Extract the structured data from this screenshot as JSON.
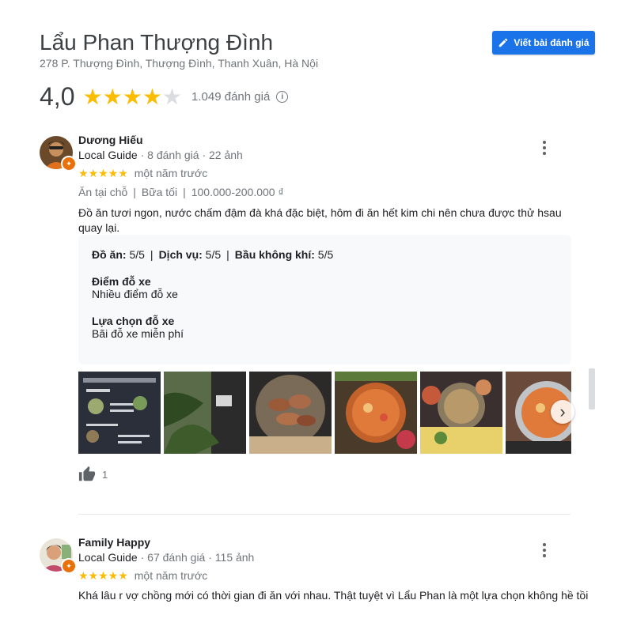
{
  "place": {
    "name": "Lẩu Phan Thượng Đình",
    "address": "278 P. Thượng Đình, Thượng Đình, Thanh Xuân, Hà Nội",
    "rating": "4,0",
    "stars_filled": 4,
    "review_count": "1.049 đánh giá"
  },
  "actions": {
    "write_review": "Viết bài đánh giá",
    "pencil_icon": "pencil-icon",
    "info_icon": "info-icon"
  },
  "colors": {
    "accent": "#1a73e8",
    "star": "#fbbc04",
    "local_guide_badge": "#e8710a"
  },
  "reviews": [
    {
      "name": "Dương Hiếu",
      "guide": "Local Guide",
      "meta": " · 8 đánh giá · 22 ảnh",
      "stars": "★★★★★",
      "time": "một năm trước",
      "tags": [
        "Ăn tại chỗ",
        "Bữa tối",
        "100.000-200.000 ₫"
      ],
      "text": "Đồ ăn tươi ngon, nước chấm đậm đà khá đặc biệt, hôm đi ăn hết kim chi nên chưa được thử hsau quay lại.",
      "scores": [
        {
          "label": "Đồ ăn:",
          "value": " 5/5"
        },
        {
          "label": "Dịch vụ:",
          "value": " 5/5"
        },
        {
          "label": "Bầu không khí:",
          "value": " 5/5"
        }
      ],
      "details": [
        {
          "label": "Điểm đỗ xe",
          "value": "Nhiều điểm đỗ xe"
        },
        {
          "label": "Lựa chọn đỗ xe",
          "value": "Bãi đỗ xe miễn phí"
        }
      ],
      "likes": "1"
    },
    {
      "name": "Family Happy",
      "guide": "Local Guide",
      "meta": " · 67 đánh giá · 115 ảnh",
      "stars": "★★★★★",
      "time": "một năm trước",
      "text": "Khá lâu r vợ chồng mới có thời gian đi ăn với nhau. Thật tuyệt vì Lẩu Phan là một lựa chọn không hề tồi"
    }
  ]
}
